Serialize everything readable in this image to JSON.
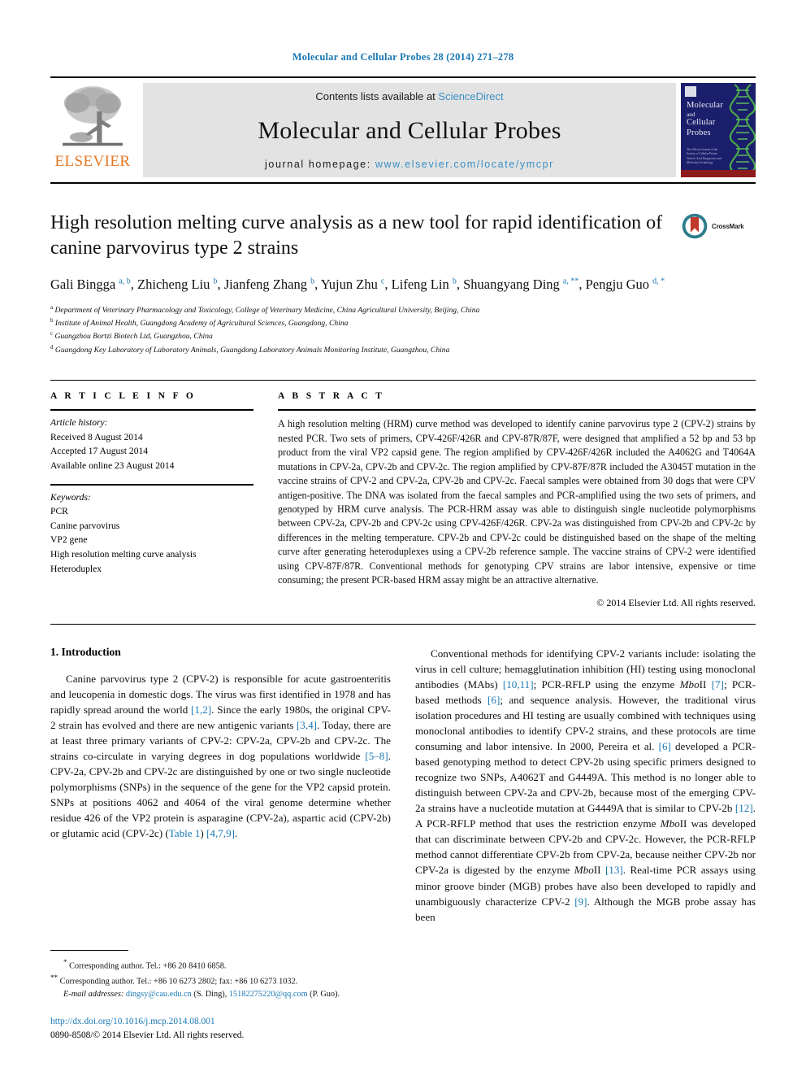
{
  "running_head": "Molecular and Cellular Probes 28 (2014) 271–278",
  "masthead": {
    "contents_prefix": "Contents lists available at ",
    "sciencedirect": "ScienceDirect",
    "journal_name": "Molecular and Cellular Probes",
    "homepage_prefix": "journal homepage: ",
    "homepage_url": "www.elsevier.com/locate/ymcpr",
    "publisher": "ELSEVIER",
    "cover": {
      "line1": "Molecular",
      "line2": "and",
      "line3": "Cellular",
      "line4": "Probes",
      "blurb": "The Official Journal of the Society of Cellular Probes, Nucleic Acid Diagnostics and Molecular Technology"
    }
  },
  "article": {
    "title": "High resolution melting curve analysis as a new tool for rapid identification of canine parvovirus type 2 strains",
    "crossmark_label": "CrossMark",
    "authors_html": "Gali Bingga <sup>a, b</sup>, Zhicheng Liu <sup>b</sup>, Jianfeng Zhang <sup>b</sup>, Yujun Zhu <sup>c</sup>, Lifeng Lin <sup>b</sup>, Shuangyang Ding <sup>a, **</sup>, Pengju Guo <sup>d, *</sup>",
    "affiliations": [
      {
        "marker": "a",
        "text": "Department of Veterinary Pharmacology and Toxicology, College of Veterinary Medicine, China Agricultural University, Beijing, China"
      },
      {
        "marker": "b",
        "text": "Institute of Animal Health, Guangdong Academy of Agricultural Sciences, Guangdong, China"
      },
      {
        "marker": "c",
        "text": "Guangzhou Bortzi Biotech Ltd, Guangzhou, China"
      },
      {
        "marker": "d",
        "text": "Guangdong Key Laboratory of Laboratory Animals, Guangdong Laboratory Animals Monitoring Institute, Guangzhou, China"
      }
    ]
  },
  "article_info": {
    "heading": "A R T I C L E  I N F O",
    "history_label": "Article history:",
    "history": [
      "Received 8 August 2014",
      "Accepted 17 August 2014",
      "Available online 23 August 2014"
    ],
    "keywords_label": "Keywords:",
    "keywords": [
      "PCR",
      "Canine parvovirus",
      "VP2 gene",
      "High resolution melting curve analysis",
      "Heteroduplex"
    ]
  },
  "abstract": {
    "heading": "A B S T R A C T",
    "text": "A high resolution melting (HRM) curve method was developed to identify canine parvovirus type 2 (CPV-2) strains by nested PCR. Two sets of primers, CPV-426F/426R and CPV-87R/87F, were designed that amplified a 52 bp and 53 bp product from the viral VP2 capsid gene. The region amplified by CPV-426F/426R included the A4062G and T4064A mutations in CPV-2a, CPV-2b and CPV-2c. The region amplified by CPV-87F/87R included the A3045T mutation in the vaccine strains of CPV-2 and CPV-2a, CPV-2b and CPV-2c. Faecal samples were obtained from 30 dogs that were CPV antigen-positive. The DNA was isolated from the faecal samples and PCR-amplified using the two sets of primers, and genotyped by HRM curve analysis. The PCR-HRM assay was able to distinguish single nucleotide polymorphisms between CPV-2a, CPV-2b and CPV-2c using CPV-426F/426R. CPV-2a was distinguished from CPV-2b and CPV-2c by differences in the melting temperature. CPV-2b and CPV-2c could be distinguished based on the shape of the melting curve after generating heteroduplexes using a CPV-2b reference sample. The vaccine strains of CPV-2 were identified using CPV-87F/87R. Conventional methods for genotyping CPV strains are labor intensive, expensive or time consuming; the present PCR-based HRM assay might be an attractive alternative.",
    "copyright": "© 2014 Elsevier Ltd. All rights reserved."
  },
  "introduction": {
    "heading": "1.  Introduction",
    "paragraph_left_html": "Canine parvovirus type 2 (CPV-2) is responsible for acute gastroenteritis and leucopenia in domestic dogs. The virus was first identified in 1978 and has rapidly spread around the world <span class=\"ref\">[1,2]</span>. Since the early 1980s, the original CPV-2 strain has evolved and there are new antigenic variants <span class=\"ref\">[3,4]</span>. Today, there are at least three primary variants of CPV-2: CPV-2a, CPV-2b and CPV-2c. The strains co-circulate in varying degrees in dog populations worldwide <span class=\"ref\">[5–8]</span>. CPV-2a, CPV-2b and CPV-2c are distinguished by one or two single nucleotide polymorphisms (SNPs) in the sequence of the gene for the VP2 capsid protein. SNPs at positions 4062 and 4064 of the viral genome determine whether residue 426 of the VP2 protein is asparagine (CPV-2a), aspartic acid (CPV-2b) or glutamic acid (CPV-2c) (<span class=\"ref\">Table 1</span>) <span class=\"ref\">[4,7,9]</span>.",
    "paragraph_right_html": "Conventional methods for identifying CPV-2 variants include: isolating the virus in cell culture; hemagglutination inhibition (HI) testing using monoclonal antibodies (MAbs) <span class=\"ref\">[10,11]</span>; PCR-RFLP using the enzyme <i>Mbo</i>II <span class=\"ref\">[7]</span>; PCR-based methods <span class=\"ref\">[6]</span>; and sequence analysis. However, the traditional virus isolation procedures and HI testing are usually combined with techniques using monoclonal antibodies to identify CPV-2 strains, and these protocols are time consuming and labor intensive. In 2000, Pereira et al. <span class=\"ref\">[6]</span> developed a PCR-based genotyping method to detect CPV-2b using specific primers designed to recognize two SNPs, A4062T and G4449A. This method is no longer able to distinguish between CPV-2a and CPV-2b, because most of the emerging CPV-2a strains have a nucleotide mutation at G4449A that is similar to CPV-2b <span class=\"ref\">[12]</span>. A PCR-RFLP method that uses the restriction enzyme <i>Mbo</i>II was developed that can discriminate between CPV-2b and CPV-2c. However, the PCR-RFLP method cannot differentiate CPV-2b from CPV-2a, because neither CPV-2b nor CPV-2a is digested by the enzyme <i>Mbo</i>II <span class=\"ref\">[13]</span>. Real-time PCR assays using minor groove binder (MGB) probes have also been developed to rapidly and unambiguously characterize CPV-2 <span class=\"ref\">[9]</span>. Although the MGB probe assay has been"
  },
  "footnotes": {
    "line1_html": "<sup>*</sup> Corresponding author. Tel.: +86 20 8410 6858.",
    "line2_html": "<sup>**</sup> Corresponding author. Tel.: +86 10 6273 2802; fax: +86 10 6273 1032.",
    "email_label": "E-mail addresses:",
    "email1": "dingsy@cau.edu.cn",
    "email1_attr": "(S. Ding),",
    "email2": "15182275220@qq.com",
    "email2_attr": "(P. Guo)."
  },
  "doi_block": {
    "doi": "http://dx.doi.org/10.1016/j.mcp.2014.08.001",
    "issn_line": "0890-8508/© 2014 Elsevier Ltd. All rights reserved."
  },
  "colors": {
    "link_blue": "#1a78b4",
    "sciencedirect_blue": "#3a8fc4",
    "elsevier_orange": "#e87722",
    "cover_navy": "#1b1f6b",
    "crossmark_teal": "#2e7d8c",
    "crossmark_red": "#c0392b"
  }
}
